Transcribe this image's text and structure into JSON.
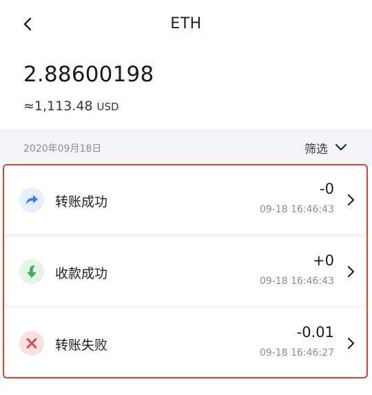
{
  "header": {
    "title": "ETH",
    "back_icon": "chevron-left-icon"
  },
  "balance": {
    "amount": "2.88600198",
    "fiat_value": "≈1,113.48",
    "fiat_unit": "USD"
  },
  "date_bar": {
    "date": "2020年09月18日",
    "filter_label": "筛选",
    "filter_icon": "chevron-down-icon"
  },
  "transactions": [
    {
      "label": "转账成功",
      "amount": "-0",
      "time": "09-18 16:46:43",
      "icon": "send-arrow-icon",
      "icon_color": "#3a7bf2",
      "icon_bg": "#e6efff"
    },
    {
      "label": "收款成功",
      "amount": "+0",
      "time": "09-18 16:46:43",
      "icon": "receive-arrow-icon",
      "icon_color": "#3fae5a",
      "icon_bg": "#e4f4e8"
    },
    {
      "label": "转账失败",
      "amount": "-0.01",
      "time": "09-18 16:46:27",
      "icon": "failed-x-icon",
      "icon_color": "#e04545",
      "icon_bg": "#fbe1e1"
    }
  ],
  "highlight_color": "#e0422a"
}
